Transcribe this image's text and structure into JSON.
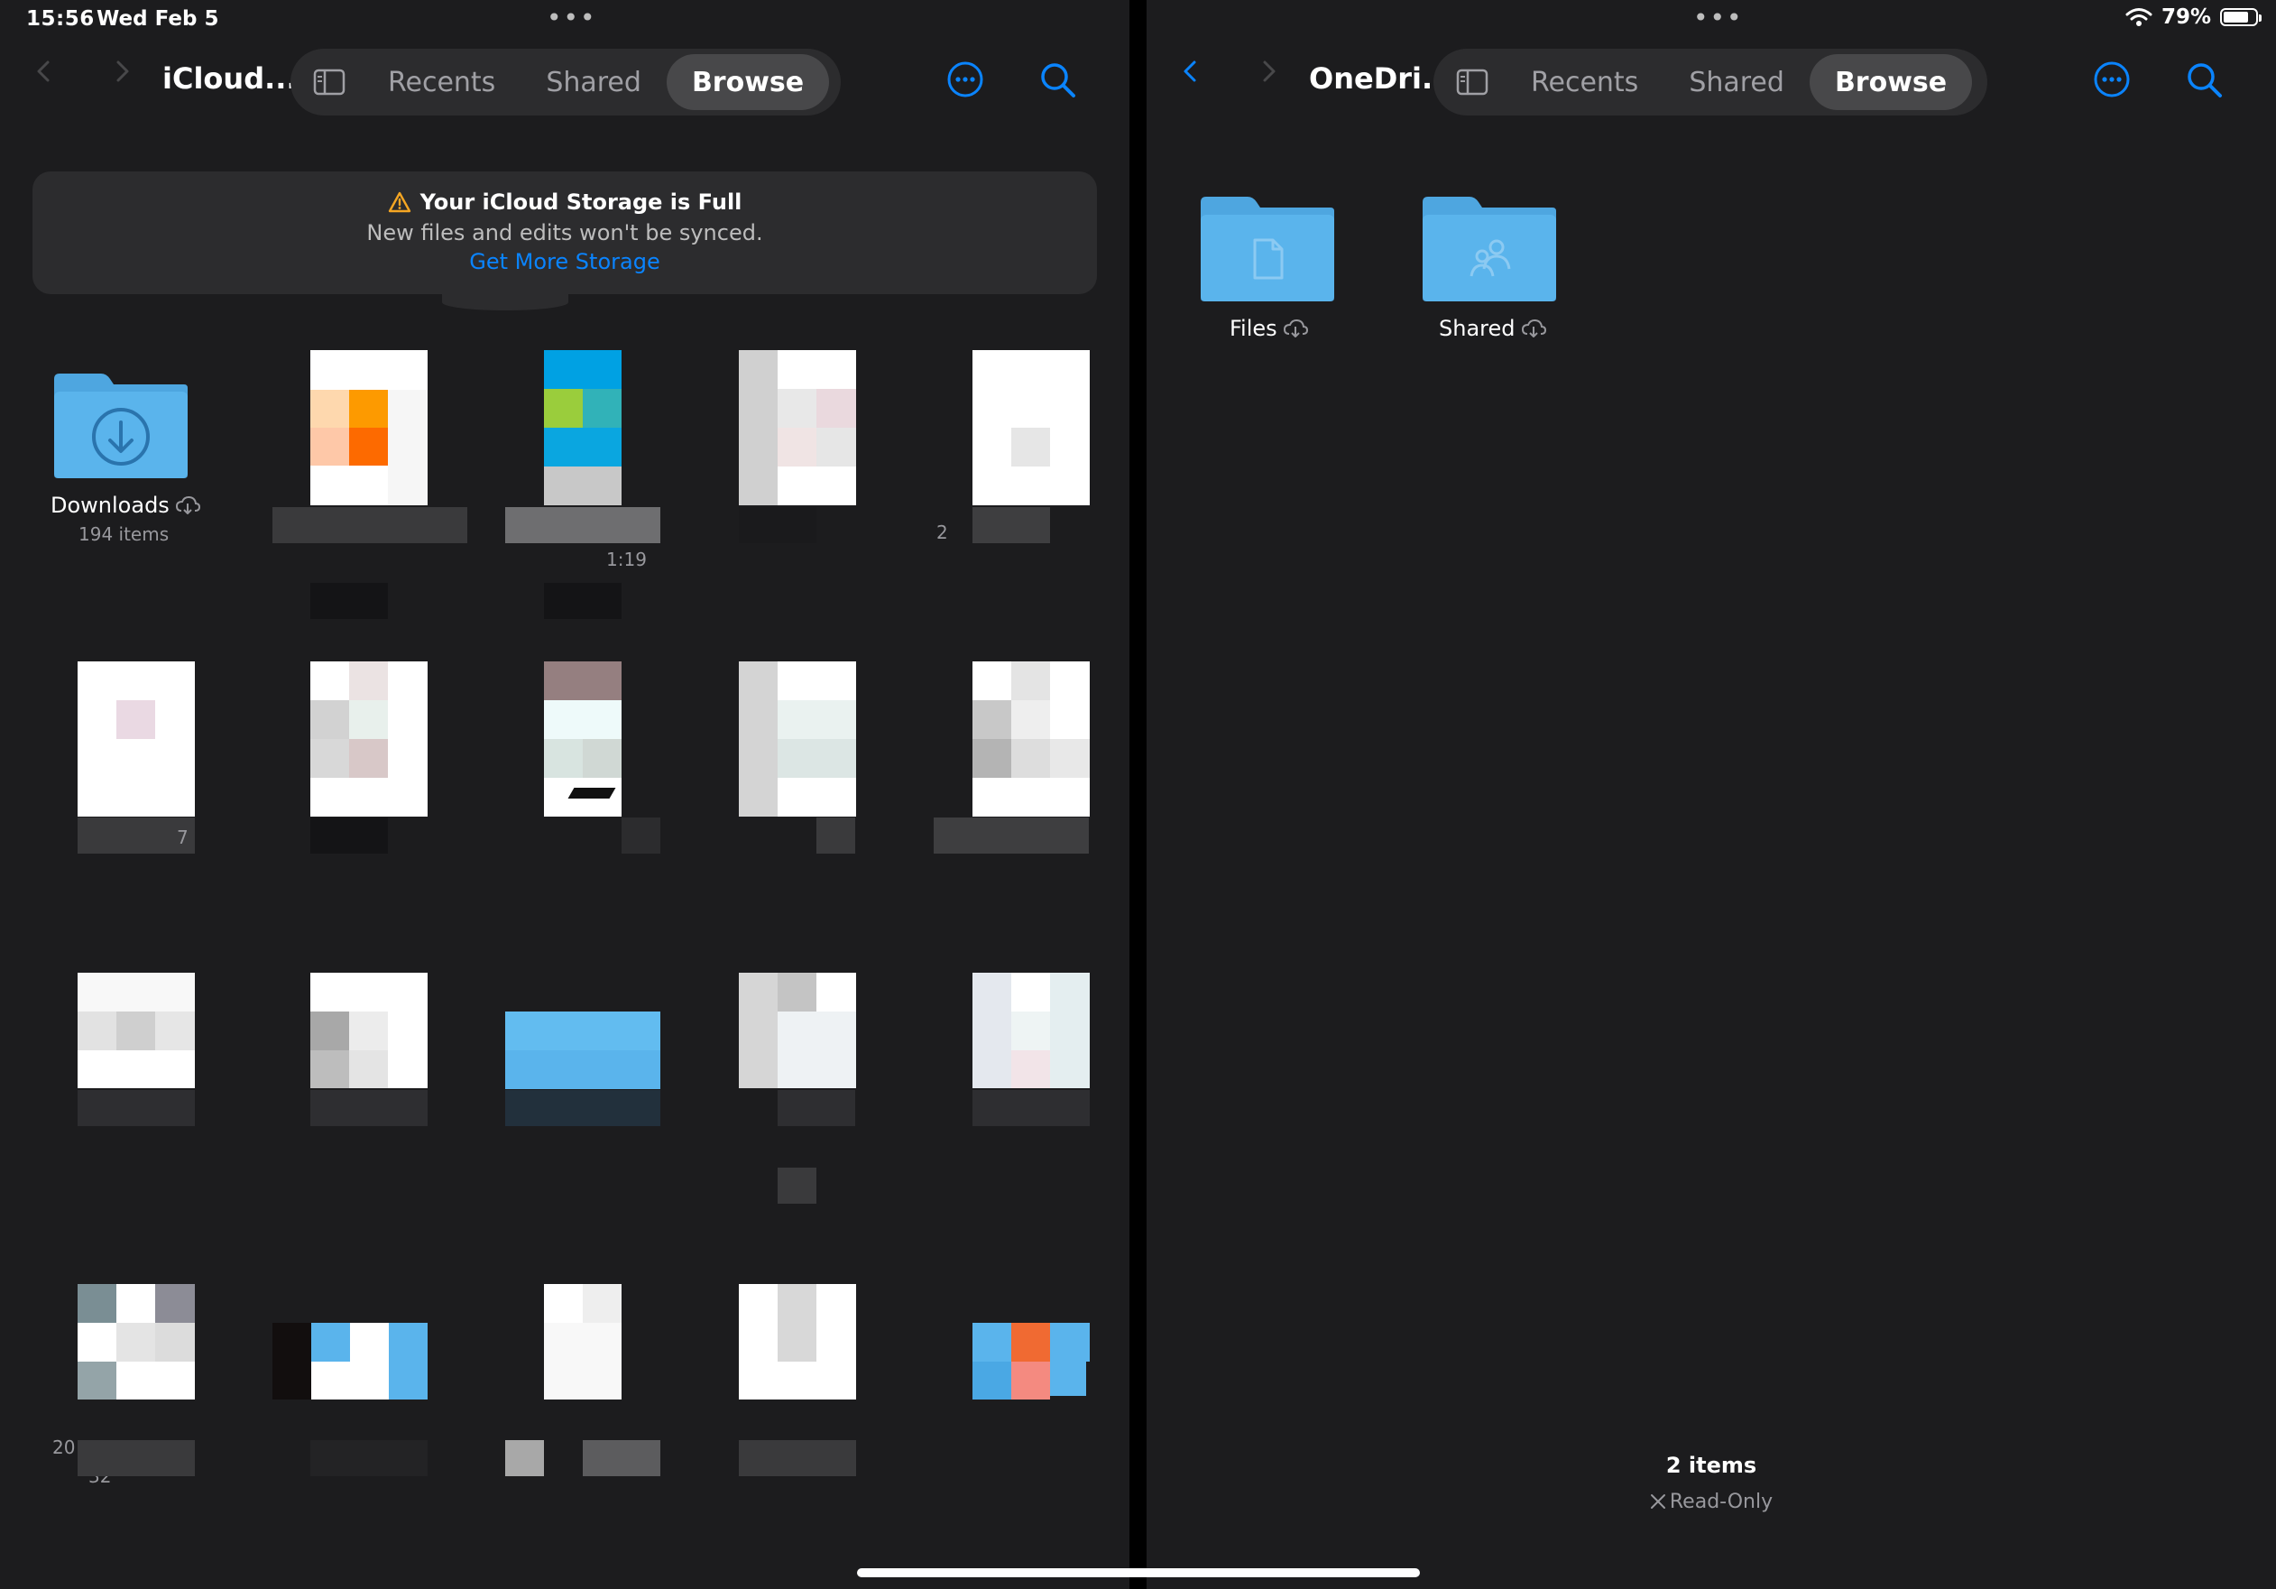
{
  "status_bar": {
    "time": "15:56",
    "date": "Wed Feb 5",
    "battery_percent": "79%",
    "battery_level": 0.79
  },
  "colors": {
    "accent": "#0a84ff",
    "folder_blue": "#5ab4ec",
    "background": "#1c1c1e",
    "warning": "#f5a623"
  },
  "left_pane": {
    "title": "iCloud...",
    "tabs": [
      {
        "label": "Recents"
      },
      {
        "label": "Shared"
      },
      {
        "label": "Browse"
      }
    ],
    "banner": {
      "icon": "warning-triangle-icon",
      "title": "Your iCloud Storage is Full",
      "message": "New files and edits won't be synced.",
      "link": "Get More Storage"
    },
    "downloads_folder": {
      "name": "Downloads",
      "count": "194 items",
      "icon": "download-folder-icon"
    },
    "fragments": {
      "a": "1:19",
      "b": "2",
      "c": "7",
      "d": "20",
      "e": "32"
    }
  },
  "right_pane": {
    "title": "OneDri...",
    "tabs": [
      {
        "label": "Recents"
      },
      {
        "label": "Shared"
      },
      {
        "label": "Browse"
      }
    ],
    "folders": [
      {
        "name": "Files",
        "icon": "document-folder-icon"
      },
      {
        "name": "Shared",
        "icon": "shared-folder-icon"
      }
    ],
    "footer": {
      "count": "2 items",
      "status": "Read-Only"
    }
  }
}
